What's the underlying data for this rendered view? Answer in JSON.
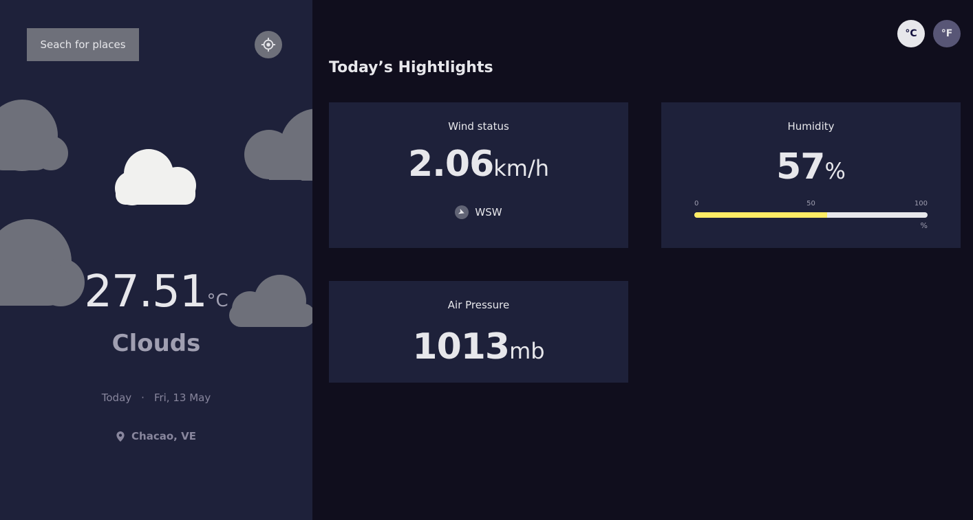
{
  "sidebar": {
    "search_label": "Seach for places",
    "temperature": "27.51",
    "temperature_unit": "°C",
    "condition": "Clouds",
    "date_today": "Today",
    "date_separator": "·",
    "date_value": "Fri, 13 May",
    "location": "Chacao, VE",
    "icons": {
      "locate": "gps-crosshair-icon",
      "location": "location-pin-icon",
      "weather": "cloud-icon"
    }
  },
  "units": {
    "celsius_label": "°C",
    "fahrenheit_label": "°F",
    "selected": "celsius"
  },
  "highlights": {
    "title": "Today’s Hightlights",
    "wind": {
      "title": "Wind status",
      "value": "2.06",
      "unit": "km/h",
      "direction": "WSW",
      "direction_icon": "navigation-arrow-icon"
    },
    "humidity": {
      "title": "Humidity",
      "value": "57",
      "unit": "%",
      "percent": 57,
      "scale_min": "0",
      "scale_mid": "50",
      "scale_max": "100",
      "scale_unit": "%"
    },
    "pressure": {
      "title": "Air Pressure",
      "value": "1013",
      "unit": "mb"
    }
  },
  "colors": {
    "sidebar_bg": "#1e213a",
    "page_bg": "#100e1d",
    "humidity_bar": "#ffec65",
    "card_bg": "#1e213a"
  }
}
